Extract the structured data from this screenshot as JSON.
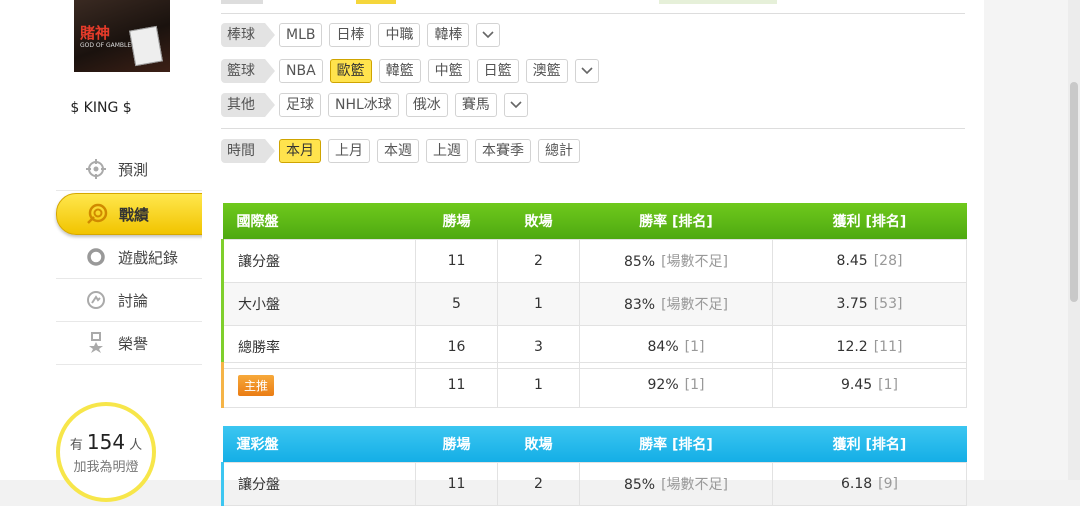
{
  "sidebar": {
    "avatar": {
      "brand": "賭神",
      "sub": "GOD OF GAMBLERS"
    },
    "username": "$ KING $",
    "nav": [
      {
        "label": "預測",
        "icon": "crosshair-icon"
      },
      {
        "label": "戰績",
        "icon": "target-badge-icon",
        "active": true
      },
      {
        "label": "遊戲紀錄",
        "icon": "ring-icon"
      },
      {
        "label": "討論",
        "icon": "chat-bubble-icon"
      },
      {
        "label": "榮譽",
        "icon": "award-ribbon-icon"
      }
    ],
    "fans": {
      "prefix": "有",
      "count": "154",
      "suffix": "人",
      "cta": "加我為明燈"
    }
  },
  "filters": {
    "baseball": {
      "label": "棒球",
      "options": [
        "MLB",
        "日棒",
        "中職",
        "韓棒"
      ]
    },
    "basketball": {
      "label": "籃球",
      "options": [
        "NBA",
        "歐籃",
        "韓籃",
        "中籃",
        "日籃",
        "澳籃"
      ],
      "active": "歐籃"
    },
    "other": {
      "label": "其他",
      "options": [
        "足球",
        "NHL冰球",
        "俄冰",
        "賽馬"
      ]
    },
    "time": {
      "label": "時間",
      "options": [
        "本月",
        "上月",
        "本週",
        "上週",
        "本賽季",
        "總計"
      ],
      "active": "本月"
    }
  },
  "tables": {
    "international": {
      "headers": [
        "國際盤",
        "勝場",
        "敗場",
        "勝率 [排名]",
        "獲利 [排名]"
      ],
      "rows": [
        {
          "name": "讓分盤",
          "win": "11",
          "loss": "2",
          "rate": "85%",
          "rate_rank": "[場數不足]",
          "profit": "8.45",
          "profit_rank": "[28]"
        },
        {
          "name": "大小盤",
          "win": "5",
          "loss": "1",
          "rate": "83%",
          "rate_rank": "[場數不足]",
          "profit": "3.75",
          "profit_rank": "[53]"
        },
        {
          "name": "總勝率",
          "win": "16",
          "loss": "3",
          "rate": "84%",
          "rate_rank": "[1]",
          "profit": "12.2",
          "profit_rank": "[11]"
        }
      ],
      "main_pick": {
        "badge": "主推",
        "win": "11",
        "loss": "1",
        "rate": "92%",
        "rate_rank": "[1]",
        "profit": "9.45",
        "profit_rank": "[1]"
      }
    },
    "lottery": {
      "headers": [
        "運彩盤",
        "勝場",
        "敗場",
        "勝率 [排名]",
        "獲利 [排名]"
      ],
      "rows": [
        {
          "name": "讓分盤",
          "win": "11",
          "loss": "2",
          "rate": "85%",
          "rate_rank": "[場數不足]",
          "profit": "6.18",
          "profit_rank": "[9]"
        }
      ]
    }
  },
  "colors": {
    "green_header": "#5cb815",
    "blue_header": "#1fb4ea",
    "active_pill": "#ffe34d",
    "badge": "#f08a1e"
  }
}
